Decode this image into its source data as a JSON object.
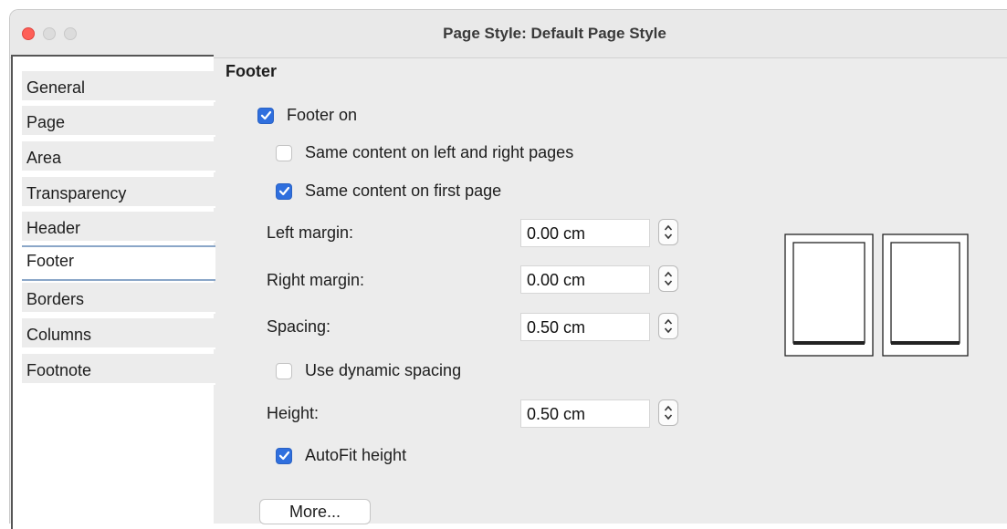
{
  "window": {
    "title": "Page Style: Default Page Style"
  },
  "tabs": [
    {
      "label": "General"
    },
    {
      "label": "Page"
    },
    {
      "label": "Area"
    },
    {
      "label": "Transparency"
    },
    {
      "label": "Header"
    },
    {
      "label": "Footer",
      "active": true
    },
    {
      "label": "Borders"
    },
    {
      "label": "Columns"
    },
    {
      "label": "Footnote"
    }
  ],
  "footer": {
    "section_title": "Footer",
    "footer_on": {
      "label": "Footer on",
      "checked": true
    },
    "same_left_right": {
      "label": "Same content on left and right pages",
      "checked": false
    },
    "same_first_page": {
      "label": "Same content on first page",
      "checked": true
    },
    "left_margin": {
      "label": "Left margin:",
      "value": "0.00 cm"
    },
    "right_margin": {
      "label": "Right margin:",
      "value": "0.00 cm"
    },
    "spacing": {
      "label": "Spacing:",
      "value": "0.50 cm"
    },
    "dynamic_spacing": {
      "label": "Use dynamic spacing",
      "checked": false
    },
    "height": {
      "label": "Height:",
      "value": "0.50 cm"
    },
    "autofit": {
      "label": "AutoFit height",
      "checked": true
    },
    "more_button": "More..."
  },
  "colors": {
    "accent": "#2f6fde",
    "close": "#fe5f57"
  }
}
